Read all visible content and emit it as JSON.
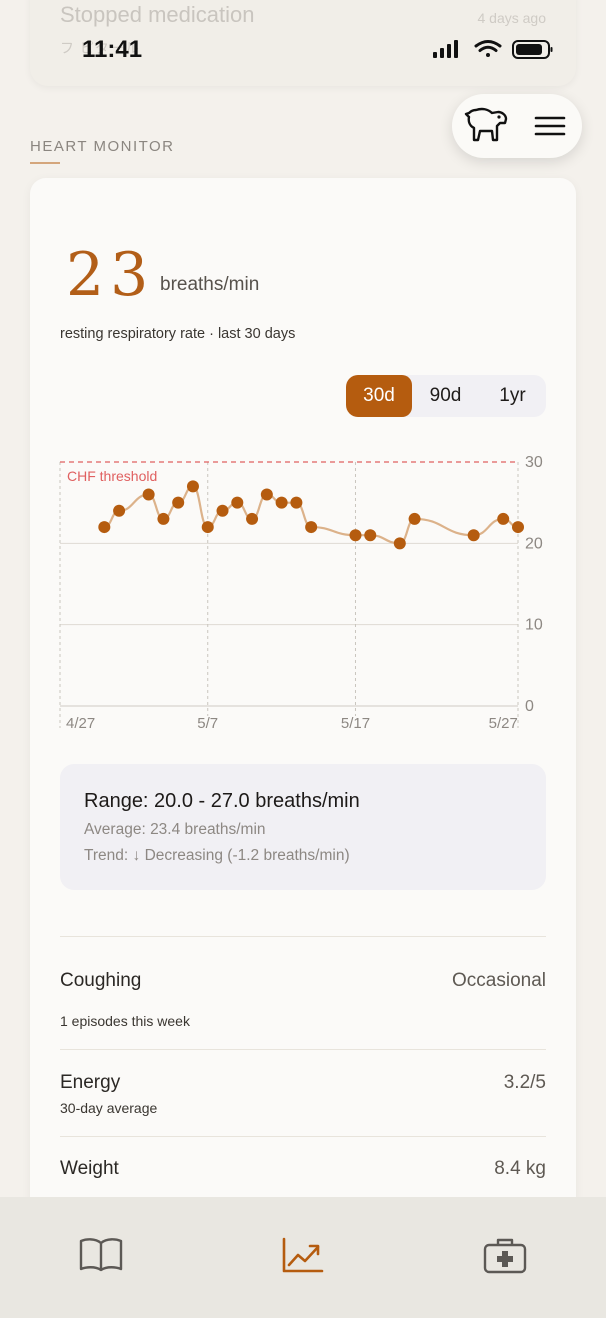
{
  "background_card": {
    "title": "Stopped medication",
    "time": "4 days ago",
    "subtitle": "フ ピタール"
  },
  "status_bar": {
    "time": "11:41"
  },
  "section": {
    "label": "HEART MONITOR"
  },
  "header_actions": {
    "profile_icon": "dog-icon",
    "menu_icon": "hamburger-menu-icon"
  },
  "metric": {
    "value": "23",
    "units": "breaths/min",
    "subtitle": "resting respiratory rate · last 30 days"
  },
  "range_selector": {
    "options": [
      "30d",
      "90d",
      "1yr"
    ],
    "selected": "30d"
  },
  "chart_data": {
    "type": "line",
    "x_ticks": [
      "4/27",
      "5/7",
      "5/17",
      "5/27"
    ],
    "y_ticks": [
      "0",
      "10",
      "20",
      "30"
    ],
    "ylim": [
      0,
      30
    ],
    "threshold": {
      "label": "CHF threshold",
      "value": 30,
      "color": "#e06060"
    },
    "series": [
      {
        "color": "#b55c0f",
        "line_color": "#dcb28a",
        "x": [
          "4/30",
          "5/1",
          "5/3",
          "5/4",
          "5/5",
          "5/6",
          "5/7",
          "5/8",
          "5/9",
          "5/10",
          "5/11",
          "5/12",
          "5/13",
          "5/14",
          "5/17",
          "5/18",
          "5/20",
          "5/21",
          "5/25",
          "5/27",
          "5/28"
        ],
        "values": [
          22,
          24,
          26,
          23,
          25,
          27,
          22,
          24,
          25,
          23,
          26,
          25,
          25,
          22,
          21,
          21,
          20,
          23,
          21,
          23,
          22
        ]
      }
    ]
  },
  "summary": {
    "range": "Range: 20.0 - 27.0 breaths/min",
    "average": "Average: 23.4 breaths/min",
    "trend": "Trend: ↓ Decreasing  (-1.2 breaths/min)"
  },
  "rows": [
    {
      "title": "Coughing",
      "value": "Occasional",
      "sub": "1 episodes this week"
    },
    {
      "title": "Energy",
      "value": "3.2/5",
      "sub": "30-day average"
    },
    {
      "title": "Weight",
      "value": "8.4 kg",
      "sub": ""
    }
  ],
  "tab_bar": {
    "tabs": [
      {
        "icon": "book-icon",
        "active": false
      },
      {
        "icon": "trend-chart-icon",
        "active": true
      },
      {
        "icon": "first-aid-kit-icon",
        "active": false
      }
    ]
  }
}
